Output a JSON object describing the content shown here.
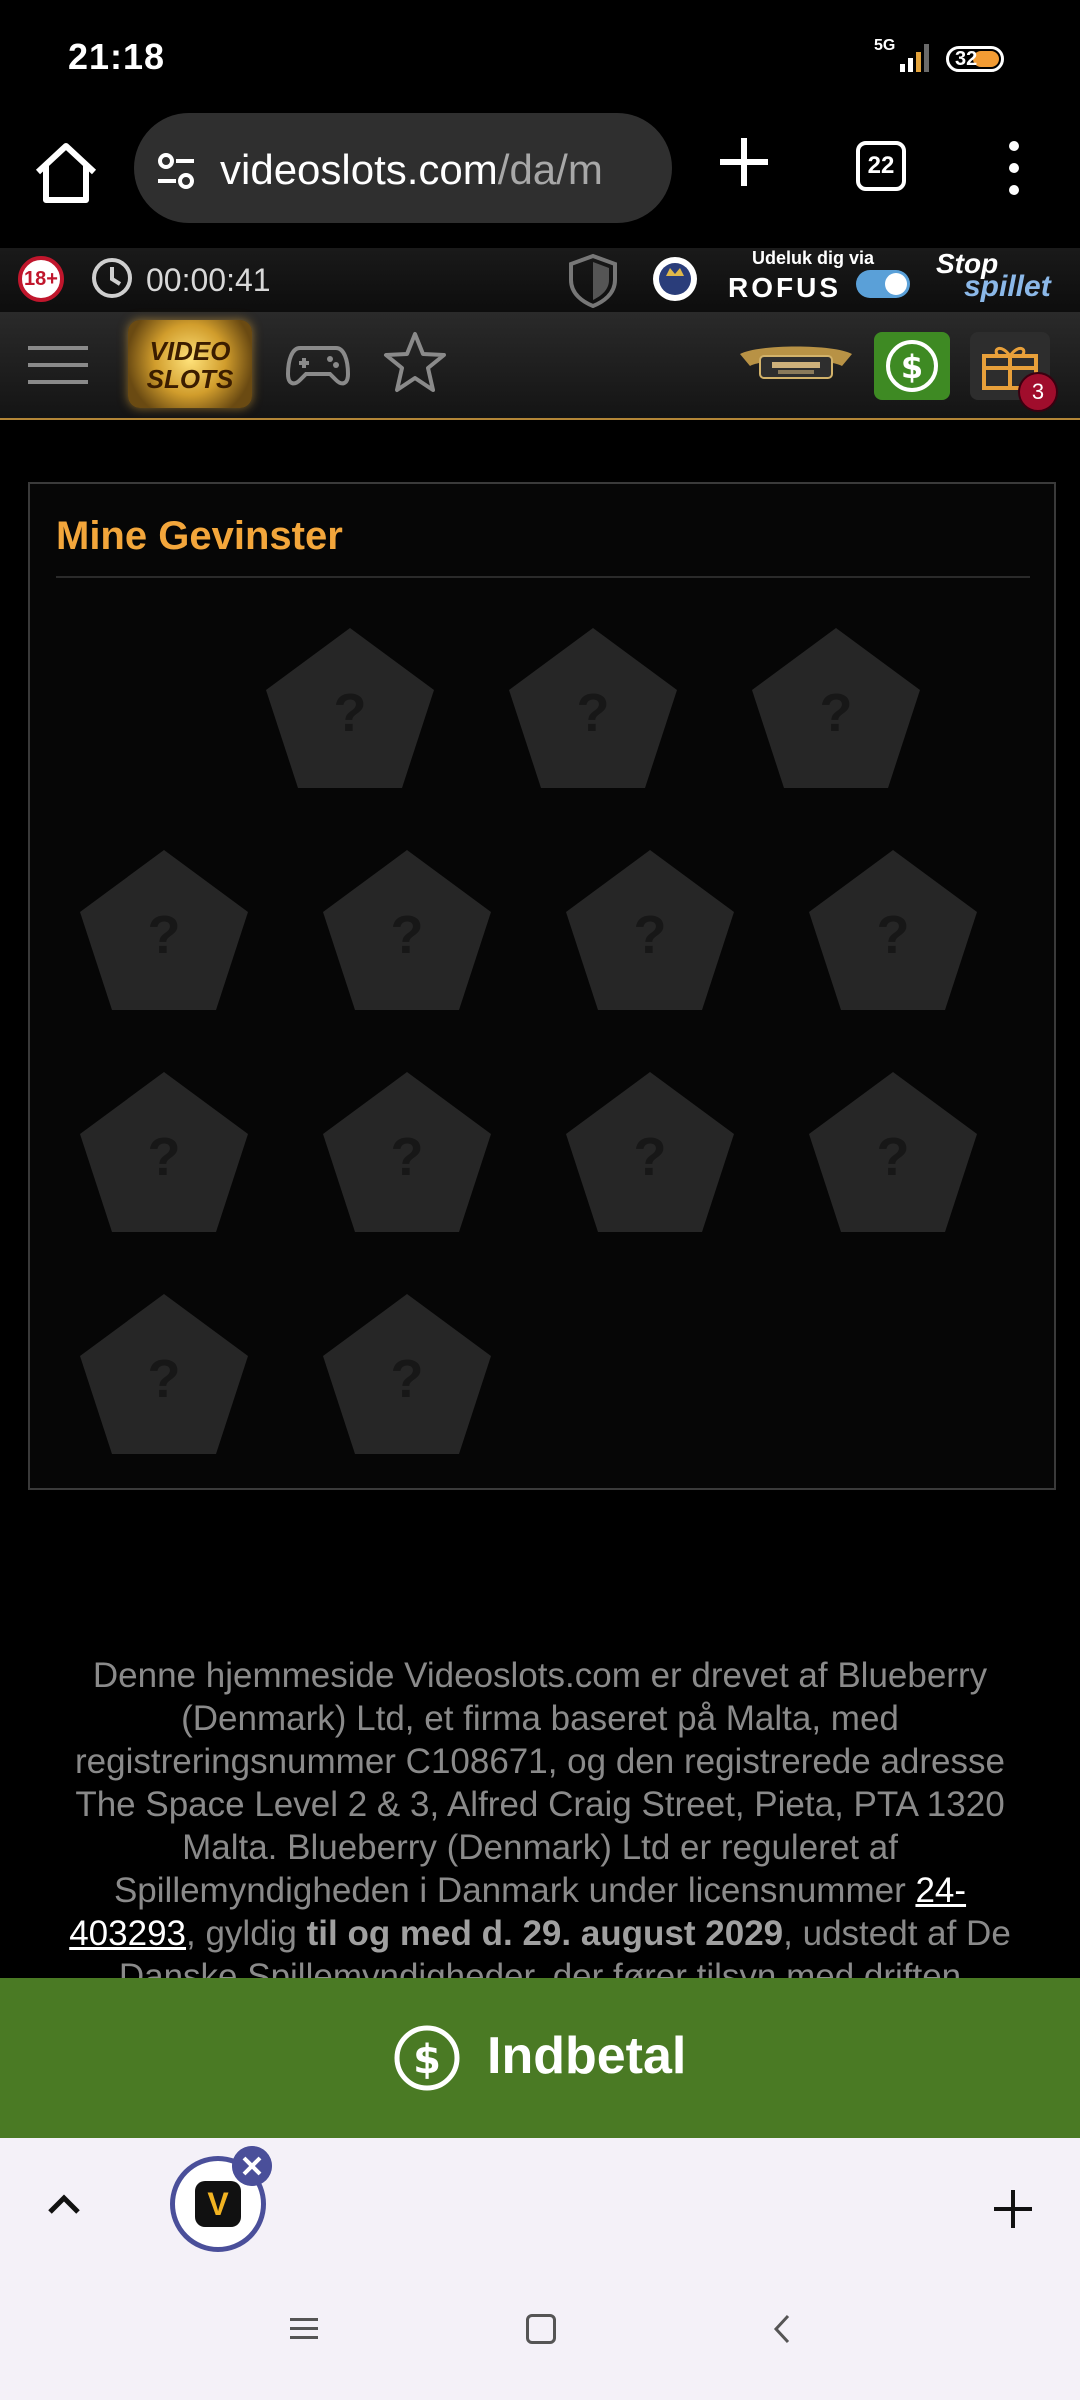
{
  "status_bar": {
    "time": "21:18",
    "network": "5G",
    "battery": "32"
  },
  "browser": {
    "url_host": "videoslots.com",
    "url_path": "/da/m",
    "tab_count": "22"
  },
  "site_strip": {
    "age_badge": "18+",
    "session_timer": "00:00:41",
    "rofus_caption": "Udeluk dig via",
    "rofus_name": "ROFUS",
    "stopspillet_top": "Stop",
    "stopspillet_bottom": "spillet"
  },
  "site_nav": {
    "logo_line1": "VIDEO",
    "logo_line2": "SLOTS",
    "gift_count": "3"
  },
  "panel": {
    "title": "Mine Gevinster",
    "prize_placeholder": "?",
    "prize_count": 14
  },
  "footer": {
    "text_1": "Denne hjemmeside Videoslots.com er drevet af Blueberry (Denmark) Ltd, et firma baseret på Malta, med registreringsnummer C108671, og den registrerede adresse The Space Level 2 & 3, Alfred Craig Street, Pieta, PTA 1320 Malta. Blueberry (Denmark) Ltd er reguleret af Spillemyndigheden i Danmark under licensnummer ",
    "license_link": "24-403293",
    "text_2": ", gyldig ",
    "validity_bold": "til og med d. 29. august 2029",
    "text_3": ", udstedt af De Danske Spillemyndigheder, der fører tilsyn med driften"
  },
  "deposit": {
    "label": "Indbetal"
  },
  "colors": {
    "accent_orange": "#f3a63b",
    "deposit_green": "#4a7a24",
    "dollar_green": "#3e8a23",
    "badge_red": "#a00d2c"
  },
  "icons": [
    "home-icon",
    "tune-icon",
    "plus-icon",
    "tabs-icon",
    "more-icon",
    "clock-icon",
    "shield-icon",
    "crest-icon",
    "menu-icon",
    "gamepad-icon",
    "star-icon",
    "dollar-icon",
    "gift-icon",
    "chevron-up-icon",
    "close-icon"
  ]
}
